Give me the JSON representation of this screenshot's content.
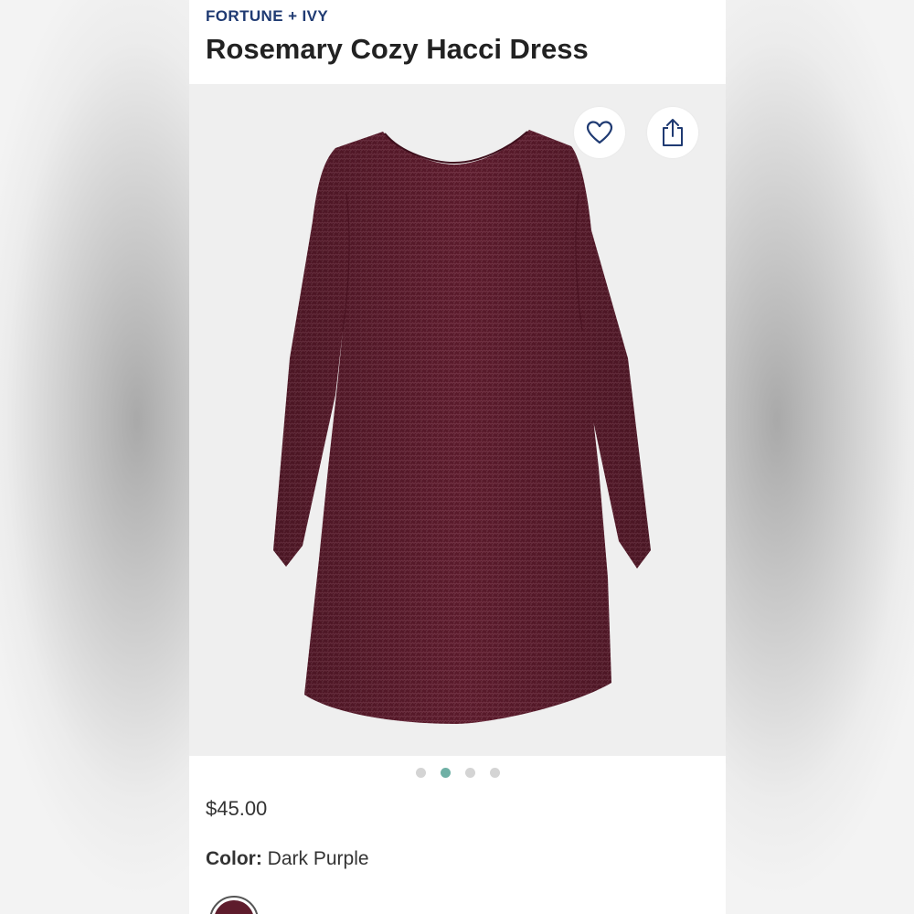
{
  "product": {
    "brand": "FORTUNE + IVY",
    "title": "Rosemary Cozy Hacci Dress",
    "price": "$45.00",
    "color_label": "Color:",
    "color_value": "Dark Purple",
    "swatch_color": "#5e1c2c",
    "dress_color": "#5a1a2b"
  },
  "gallery": {
    "image_count": 4,
    "active_index": 1
  },
  "colors": {
    "brand_text": "#1f3a72",
    "active_dot": "#6fb0a5",
    "inactive_dot": "#d4d4d4"
  }
}
